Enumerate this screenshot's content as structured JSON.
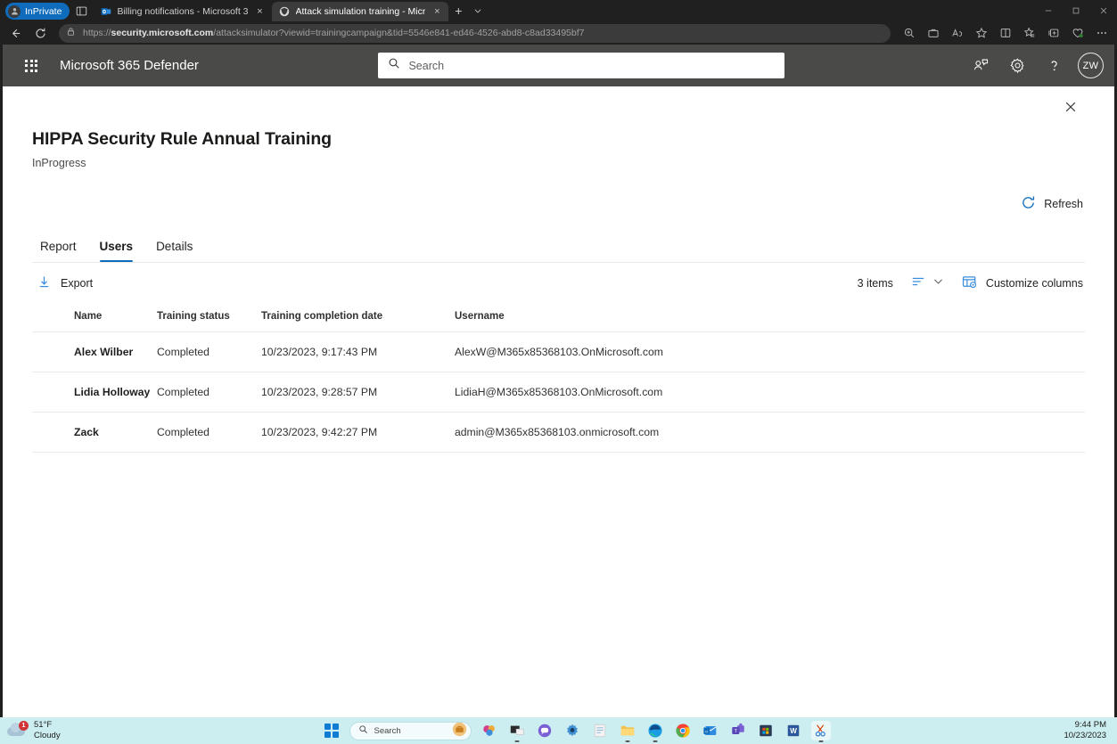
{
  "browser": {
    "inprivate_label": "InPrivate",
    "tabs": [
      {
        "title": "Billing notifications - Microsoft 3",
        "active": false,
        "favicon": "outlook-icon",
        "close": "×"
      },
      {
        "title": "Attack simulation training - Micr",
        "active": true,
        "favicon": "defender-icon",
        "close": "×"
      }
    ],
    "new_tab_label": "+",
    "tab_menu_label": "⌄",
    "window_controls": {
      "minimize": "—",
      "maximize": "❐",
      "close": "✕"
    },
    "nav": {
      "back": "←",
      "refresh": "⟳"
    },
    "url": {
      "scheme": "https://",
      "host": "security.microsoft.com",
      "path": "/attacksimulator?viewid=trainingcampaign&tid=5546e841-ed46-4526-abd8-c8ad33495bf7",
      "full": "https://security.microsoft.com/attacksimulator?viewid=trainingcampaign&tid=5546e841-ed46-4526-abd8-c8ad33495bf7"
    },
    "toolbar_icons": [
      "zoom-icon",
      "briefcase-icon",
      "read-aloud-icon",
      "favorite-star-icon",
      "split-screen-icon",
      "favorites-icon",
      "collections-icon",
      "browser-essentials-icon",
      "settings-more-icon"
    ]
  },
  "defender": {
    "brand": "Microsoft 365 Defender",
    "search": {
      "placeholder": "Search",
      "value": ""
    },
    "header_icons": [
      "person-chat-icon",
      "gear-icon",
      "help-icon"
    ],
    "avatar_initials": "ZW"
  },
  "panel": {
    "close_label": "✕",
    "title": "HIPPA Security Rule Annual Training",
    "status": "InProgress",
    "refresh_label": "Refresh",
    "tabs": [
      {
        "label": "Report",
        "active": false
      },
      {
        "label": "Users",
        "active": true
      },
      {
        "label": "Details",
        "active": false
      }
    ],
    "commandbar": {
      "export_label": "Export",
      "items_count": "3 items",
      "customize_columns_label": "Customize columns"
    },
    "table": {
      "columns": [
        "Name",
        "Training status",
        "Training completion date",
        "Username"
      ],
      "rows": [
        {
          "name": "Alex Wilber",
          "status": "Completed",
          "date": "10/23/2023, 9:17:43 PM",
          "username": "AlexW@M365x85368103.OnMicrosoft.com"
        },
        {
          "name": "Lidia Holloway",
          "status": "Completed",
          "date": "10/23/2023, 9:28:57 PM",
          "username": "LidiaH@M365x85368103.OnMicrosoft.com"
        },
        {
          "name": "Zack",
          "status": "Completed",
          "date": "10/23/2023, 9:42:27 PM",
          "username": "admin@M365x85368103.onmicrosoft.com"
        }
      ]
    }
  },
  "taskbar": {
    "weather": {
      "temp": "51°F",
      "condition": "Cloudy",
      "badge": "1"
    },
    "search_placeholder": "Search",
    "apps": [
      "copilot-icon",
      "task-view-icon",
      "teams-chat-icon",
      "settings-icon",
      "notepad-icon",
      "file-explorer-icon",
      "edge-icon",
      "chrome-icon",
      "outlook-new-icon",
      "teams-new-icon",
      "microsoft-store-icon",
      "word-icon",
      "snipping-tool-icon"
    ],
    "clock": {
      "time": "9:44 PM",
      "date": "10/23/2023"
    }
  },
  "colors": {
    "accent": "#0f6cbd",
    "chrome_bg": "#202020",
    "defender_header": "#4a4a48",
    "taskbar_bg": "#cdeef0"
  }
}
